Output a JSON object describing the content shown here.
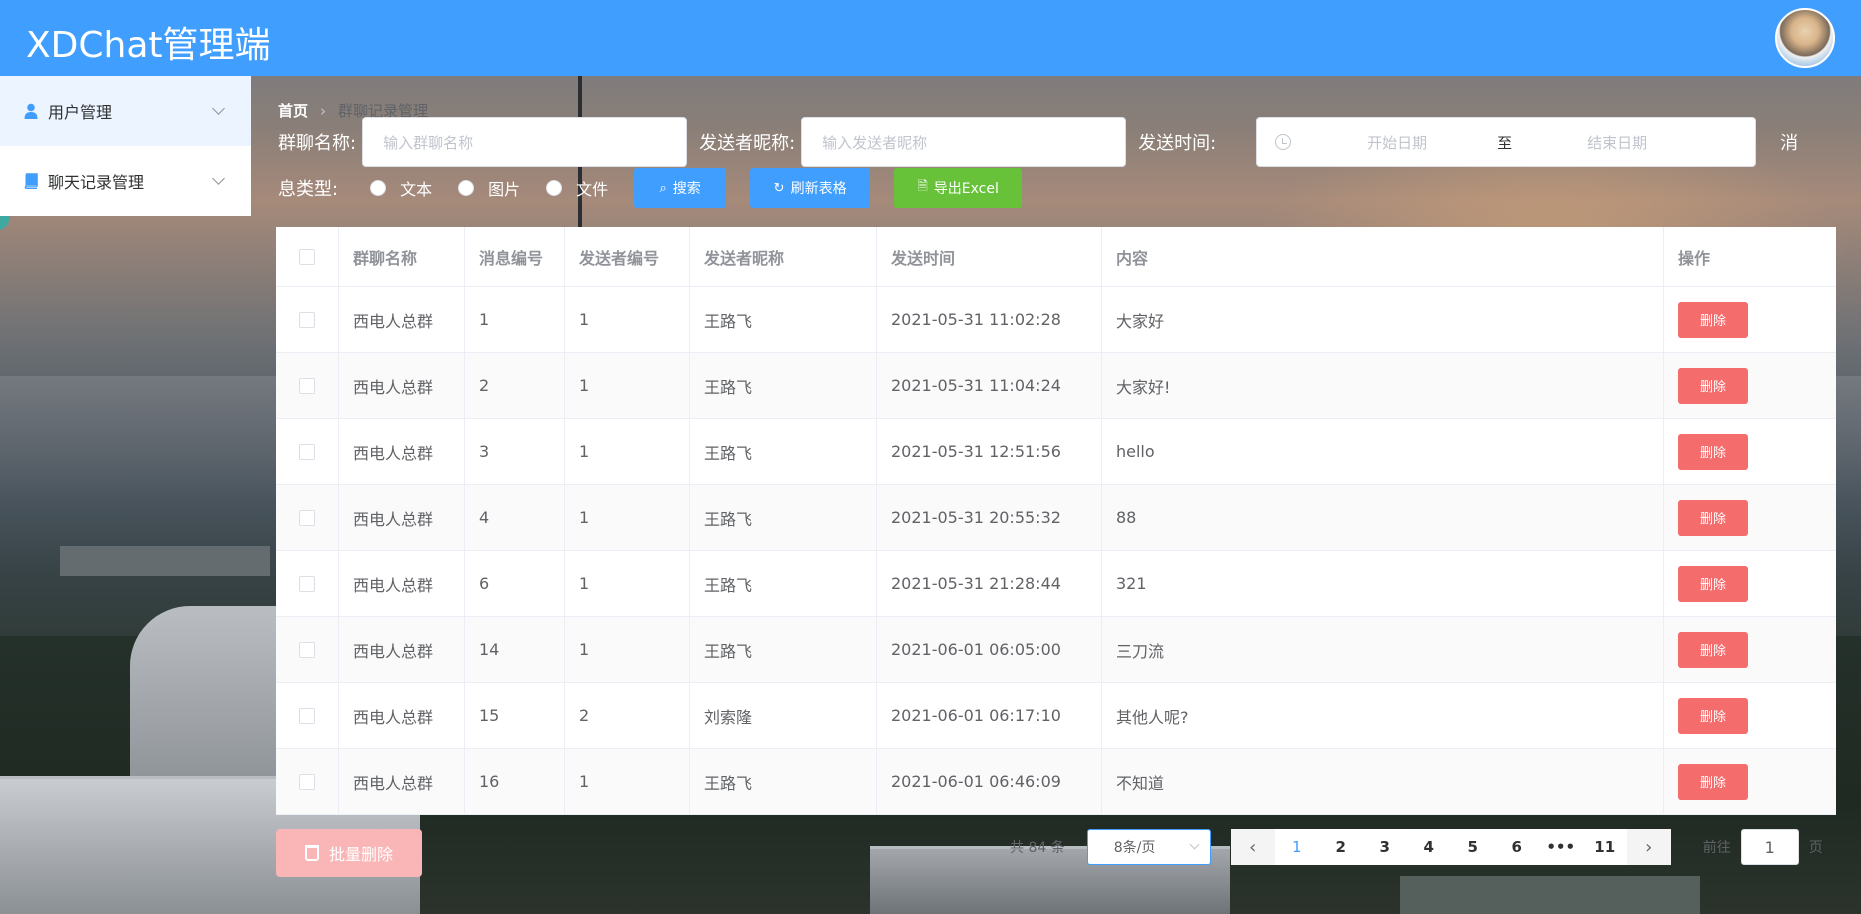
{
  "header": {
    "title": "XDChat管理端"
  },
  "sidebar": {
    "items": [
      {
        "label": "用户管理",
        "icon": "user-icon"
      },
      {
        "label": "聊天记录管理",
        "icon": "book-icon"
      }
    ]
  },
  "breadcrumb": {
    "home": "首页",
    "current": "群聊记录管理"
  },
  "filters": {
    "group_label": "群聊名称:",
    "group_placeholder": "输入群聊名称",
    "sender_label": "发送者昵称:",
    "sender_placeholder": "输入发送者昵称",
    "time_label": "发送时间:",
    "start_placeholder": "开始日期",
    "range_sep": "至",
    "end_placeholder": "结束日期",
    "type_label_part1": "消",
    "type_label_part2": "息类型:",
    "type_options": [
      "文本",
      "图片",
      "文件"
    ],
    "search_label": "搜索",
    "refresh_label": "刷新表格",
    "export_label": "导出Excel"
  },
  "table": {
    "columns": [
      "群聊名称",
      "消息编号",
      "发送者编号",
      "发送者昵称",
      "发送时间",
      "内容",
      "操作"
    ],
    "delete_label": "删除",
    "rows": [
      [
        "西电人总群",
        "1",
        "1",
        "王路飞",
        "2021-05-31 11:02:28",
        "大家好"
      ],
      [
        "西电人总群",
        "2",
        "1",
        "王路飞",
        "2021-05-31 11:04:24",
        "大家好!"
      ],
      [
        "西电人总群",
        "3",
        "1",
        "王路飞",
        "2021-05-31 12:51:56",
        "hello"
      ],
      [
        "西电人总群",
        "4",
        "1",
        "王路飞",
        "2021-05-31 20:55:32",
        "88"
      ],
      [
        "西电人总群",
        "6",
        "1",
        "王路飞",
        "2021-05-31 21:28:44",
        "321"
      ],
      [
        "西电人总群",
        "14",
        "1",
        "王路飞",
        "2021-06-01 06:05:00",
        "三刀流"
      ],
      [
        "西电人总群",
        "15",
        "2",
        "刘索隆",
        "2021-06-01 06:17:10",
        "其他人呢?"
      ],
      [
        "西电人总群",
        "16",
        "1",
        "王路飞",
        "2021-06-01 06:46:09",
        "不知道"
      ]
    ]
  },
  "footer": {
    "batch_delete_label": "批量删除",
    "total_text": "共 84 条",
    "page_size": "8条/页",
    "pages": [
      "1",
      "2",
      "3",
      "4",
      "5",
      "6",
      "•••",
      "11"
    ],
    "current_page": "1",
    "goto_prefix": "前往",
    "goto_value": "1",
    "goto_suffix": "页"
  },
  "colors": {
    "primary": "#409eff",
    "danger": "#f56c6c",
    "success": "#67c23a"
  }
}
